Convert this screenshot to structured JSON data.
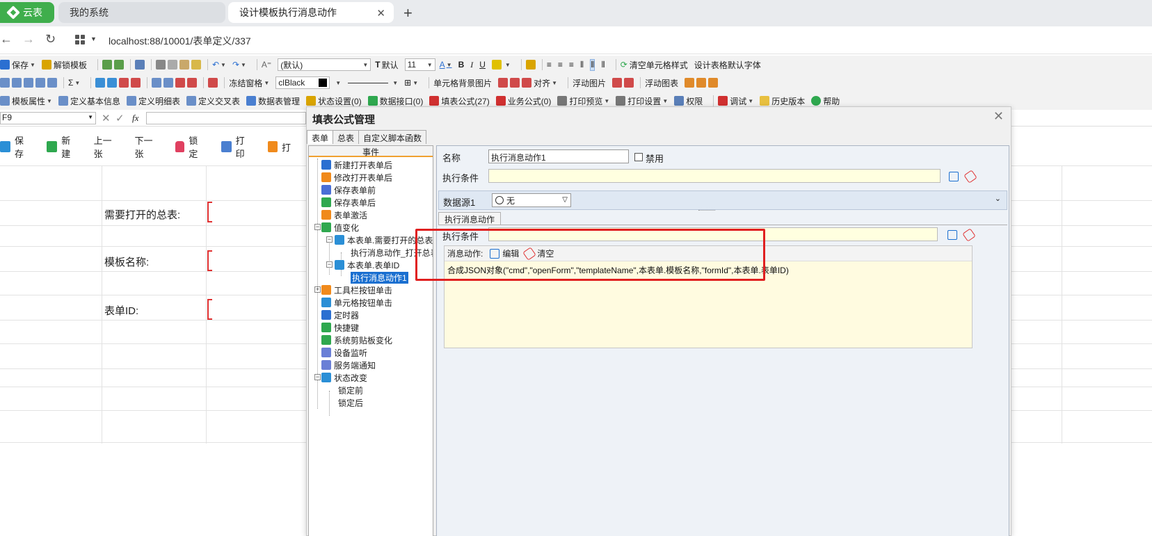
{
  "browser": {
    "brand_tab": "云表",
    "tabs": [
      {
        "label": "我的系统"
      },
      {
        "label": "设计模板执行消息动作"
      }
    ],
    "url": "localhost:88/10001/表单定义/337"
  },
  "toolbar1": {
    "save": "保存",
    "unlock_template": "解锁模板",
    "font_name": "(默认)",
    "text_default": "默认",
    "font_size": "11",
    "clear_cell_style": "清空单元格样式",
    "table_default_font": "设计表格默认字体"
  },
  "toolbar2": {
    "freeze": "冻结窗格",
    "color_value": "clBlack",
    "cell_bg_image": "单元格背景图片",
    "align": "对齐",
    "float_image": "浮动图片",
    "float_chart": "浮动图表"
  },
  "toolbar3": {
    "items": [
      "模板属性",
      "定义基本信息",
      "定义明细表",
      "定义交叉表",
      "数据表管理",
      "状态设置(0)",
      "数据接口(0)",
      "填表公式(27)",
      "业务公式(0)",
      "打印预览",
      "打印设置",
      "权限",
      "调试",
      "历史版本",
      "帮助"
    ]
  },
  "formula_bar": {
    "cell_ref": "F9"
  },
  "action_bar": {
    "items": [
      "保存",
      "新建",
      "上一张",
      "下一张",
      "锁定",
      "打印",
      "打"
    ]
  },
  "form": {
    "labels": [
      "需要打开的总表:",
      "模板名称:",
      "表单ID:"
    ]
  },
  "dialog": {
    "title": "填表公式管理",
    "tabs": [
      "表单",
      "总表",
      "自定义脚本函数"
    ],
    "tree_header": "事件",
    "tree": [
      {
        "label": "新建打开表单后",
        "icon_color": "#2b6fd1"
      },
      {
        "label": "修改打开表单后",
        "icon_color": "#f08a1c"
      },
      {
        "label": "保存表单前",
        "icon_color": "#4a6fd6"
      },
      {
        "label": "保存表单后",
        "icon_color": "#2fa84f"
      },
      {
        "label": "表单激活",
        "icon_color": "#f08a1c"
      },
      {
        "label": "值变化",
        "icon_color": "#2fa84f"
      },
      {
        "label": "本表单.需要打开的总表",
        "icon_color": "#2b8fd6"
      },
      {
        "label": "执行消息动作_打开总表",
        "icon_color": ""
      },
      {
        "label": "本表单.表单ID",
        "icon_color": "#2b8fd6"
      },
      {
        "label": "执行消息动作1",
        "icon_color": ""
      },
      {
        "label": "工具栏按钮单击",
        "icon_color": "#f08a1c"
      },
      {
        "label": "单元格按钮单击",
        "icon_color": "#2b8fd6"
      },
      {
        "label": "定时器",
        "icon_color": "#2b6fd1"
      },
      {
        "label": "快捷键",
        "icon_color": "#2fa84f"
      },
      {
        "label": "系统剪贴板变化",
        "icon_color": "#2fa84f"
      },
      {
        "label": "设备监听",
        "icon_color": "#6a7fd6"
      },
      {
        "label": "服务端通知",
        "icon_color": "#6a7fd6"
      },
      {
        "label": "状态改变",
        "icon_color": "#2b8fd6"
      },
      {
        "label": "锁定前",
        "icon_color": ""
      },
      {
        "label": "锁定后",
        "icon_color": ""
      }
    ],
    "detail": {
      "name_label": "名称",
      "name_value": "执行消息动作1",
      "disable_label": "禁用",
      "condition_label": "执行条件",
      "datasource_label": "数据源1",
      "datasource_value": "无",
      "subtab_label": "执行消息动作",
      "inner_condition_label": "执行条件",
      "msg_action_label": "消息动作:",
      "edit_label": "编辑",
      "clear_label": "清空",
      "msg_content": "合成JSON对象(\"cmd\",\"openForm\",\"templateName\",本表单.模板名称,\"formId\",本表单.表单ID)"
    }
  }
}
